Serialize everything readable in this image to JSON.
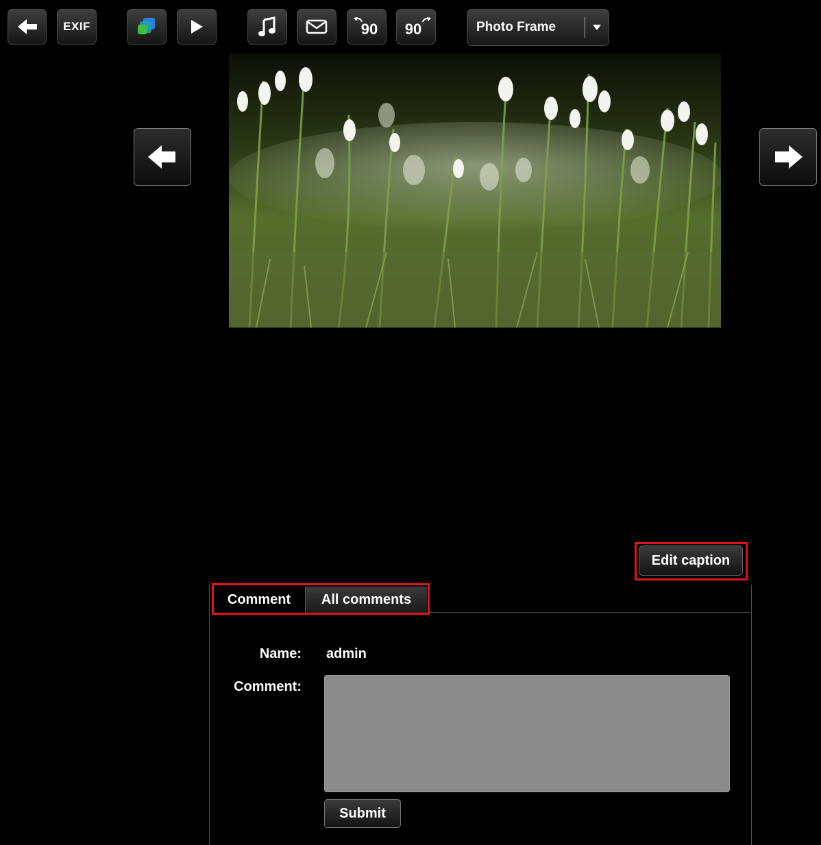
{
  "toolbar": {
    "back_icon": "arrow-left-icon",
    "exif_label": "EXIF",
    "slideshow_icon": "layers-icon",
    "play_icon": "play-icon",
    "music_icon": "music-note-icon",
    "mail_icon": "envelope-icon",
    "rotate_left_label": "90",
    "rotate_right_label": "90",
    "frame_dropdown": {
      "selected": "Photo Frame"
    }
  },
  "viewer": {
    "prev_icon": "arrow-left-icon",
    "next_icon": "arrow-right-icon",
    "photo_subject": "white snowdrop flowers in grass"
  },
  "caption": {
    "edit_label": "Edit caption"
  },
  "comments": {
    "tabs": [
      {
        "label": "Comment"
      },
      {
        "label": "All comments"
      }
    ],
    "name_label": "Name:",
    "name_value": "admin",
    "comment_label": "Comment:",
    "comment_value": "",
    "submit_label": "Submit"
  },
  "colors": {
    "highlight": "#e0161b",
    "textarea_bg": "#8b8b8b"
  }
}
